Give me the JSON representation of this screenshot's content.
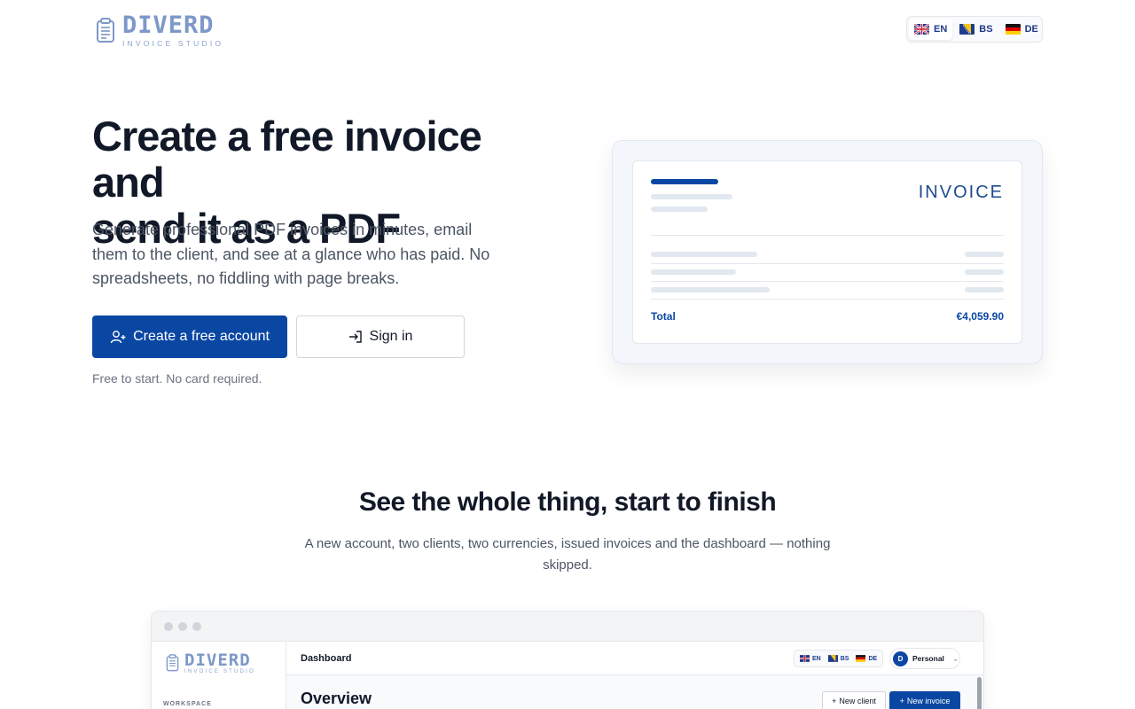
{
  "header": {
    "logo_word": "DIVERD",
    "logo_sub": "INVOICE STUDIO",
    "languages": [
      {
        "code": "EN",
        "flag": "uk-flag-icon",
        "active": true
      },
      {
        "code": "BS",
        "flag": "bosnia-flag-icon",
        "active": false
      },
      {
        "code": "DE",
        "flag": "germany-flag-icon",
        "active": false
      }
    ]
  },
  "hero": {
    "title_line1": "Create a free invoice and",
    "title_line2": "send it as a PDF",
    "description": "Generate professional PDF invoices in minutes, email them to the client, and see at a glance who has paid. No spreadsheets, no fiddling with page breaks.",
    "primary_button": "Create a free account",
    "primary_icon": "user-plus-icon",
    "secondary_button": "Sign in",
    "secondary_icon": "sign-in-icon",
    "note": "Free to start. No card required."
  },
  "invoice_preview": {
    "title": "INVOICE",
    "total_label": "Total",
    "total_value": "€4,059.90"
  },
  "section": {
    "title": "See the whole thing, start to finish",
    "description": "A new account, two clients, two currencies, issued invoices and the dashboard — nothing skipped."
  },
  "app_preview": {
    "logo_word": "DIVERD",
    "logo_sub": "INVOICE STUDIO",
    "workspace_label": "WORKSPACE",
    "topbar_title": "Dashboard",
    "languages": [
      "EN",
      "BS",
      "DE"
    ],
    "account_initial": "D",
    "account_name": "Personal",
    "page_title": "Overview",
    "new_client": "New client",
    "new_invoice": "New invoice"
  },
  "colors": {
    "brand": "#0a47a3",
    "logo": "#7d98c8"
  }
}
